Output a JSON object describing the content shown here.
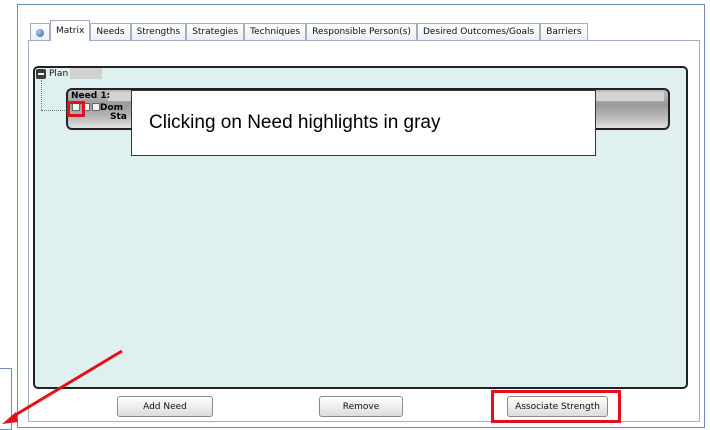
{
  "tabs": [
    {
      "label": "",
      "icon": "globe-icon",
      "active": false
    },
    {
      "label": "Matrix",
      "active": true
    },
    {
      "label": "Needs",
      "active": false
    },
    {
      "label": "Strengths",
      "active": false
    },
    {
      "label": "Strategies",
      "active": false
    },
    {
      "label": "Techniques",
      "active": false
    },
    {
      "label": "Responsible Person(s)",
      "active": false
    },
    {
      "label": "Desired Outcomes/Goals",
      "active": false
    },
    {
      "label": "Barriers",
      "active": false
    }
  ],
  "plan": {
    "label": "Plan"
  },
  "need": {
    "title": "Need 1:",
    "line1": "Dom",
    "line2": "Sta"
  },
  "callout": {
    "text": "Clicking on Need highlights in gray"
  },
  "buttons": {
    "add_need": "Add Need",
    "remove": "Remove",
    "associate_strength": "Associate Strength"
  },
  "colors": {
    "highlight": "#e3101a",
    "plan_bg": "#dff0f0",
    "selected_need": "#a9a9a9"
  }
}
